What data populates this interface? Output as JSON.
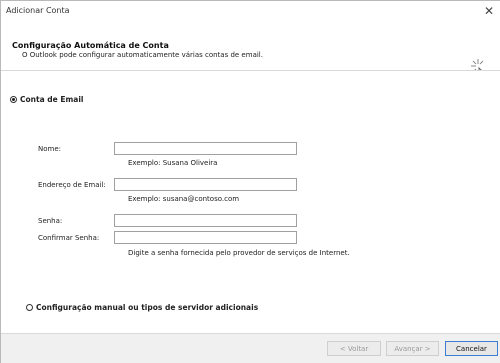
{
  "window": {
    "title": "Adicionar Conta",
    "close_glyph": "✕"
  },
  "header": {
    "title": "Configuração Automática de Conta",
    "subtitle": "O Outlook pode configurar automaticamente várias contas de email.",
    "icon": "wizard-cursor-icon"
  },
  "options": {
    "email_account": {
      "label": "Conta de Email",
      "selected": true
    },
    "manual_setup": {
      "label": "Configuração manual ou tipos de servidor adicionais",
      "selected": false
    }
  },
  "form": {
    "name": {
      "label": "Nome:",
      "value": "",
      "hint": "Exemplo: Susana Oliveira"
    },
    "email": {
      "label": "Endereço de Email:",
      "value": "",
      "hint": "Exemplo: susana@contoso.com"
    },
    "password": {
      "label": "Senha:",
      "value": ""
    },
    "confirm_password": {
      "label": "Confirmar Senha:",
      "value": "",
      "hint": "Digite a senha fornecida pelo provedor de serviços de Internet."
    }
  },
  "footer": {
    "back_label": "< Voltar",
    "next_label": "Avançar >",
    "cancel_label": "Cancelar"
  }
}
